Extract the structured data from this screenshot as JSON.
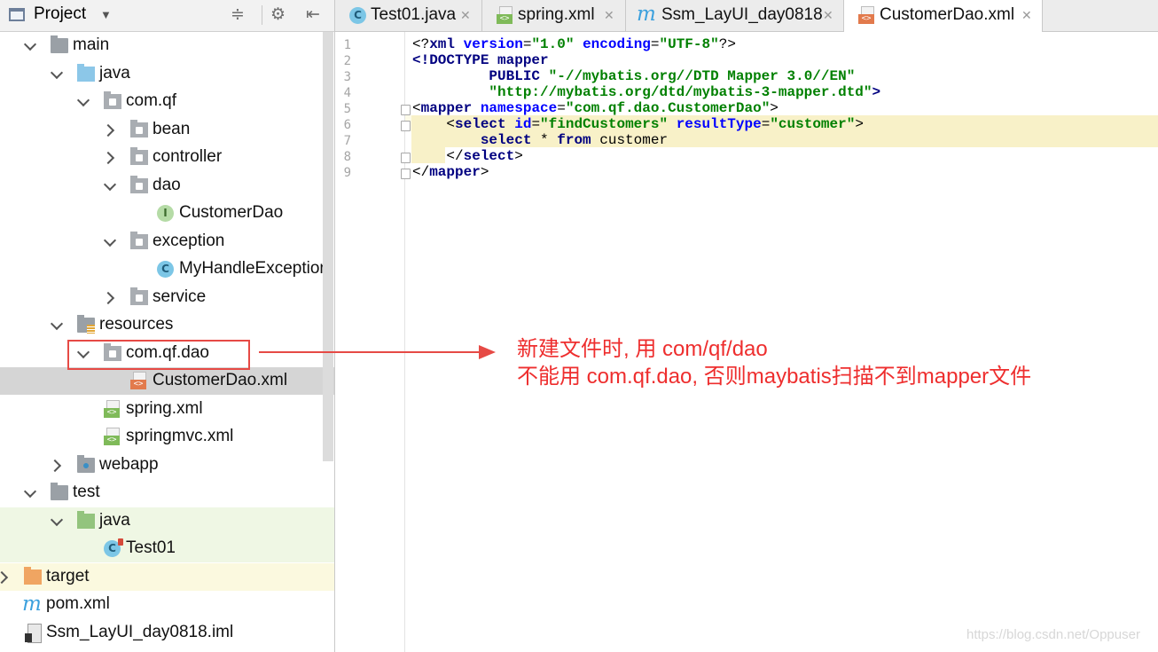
{
  "project_panel": {
    "title": "Project",
    "tree": [
      {
        "id": "main",
        "label": "main",
        "icon": "folder-gray",
        "expand": "down"
      },
      {
        "id": "java-main",
        "label": "java",
        "icon": "folder-blue",
        "expand": "down"
      },
      {
        "id": "pkg-comqf",
        "label": "com.qf",
        "icon": "package",
        "expand": "down"
      },
      {
        "id": "pkg-bean",
        "label": "bean",
        "icon": "package",
        "expand": "right"
      },
      {
        "id": "pkg-controller",
        "label": "controller",
        "icon": "package",
        "expand": "right"
      },
      {
        "id": "pkg-dao",
        "label": "dao",
        "icon": "package",
        "expand": "down"
      },
      {
        "id": "customerdao-iface",
        "label": "CustomerDao",
        "icon": "interface",
        "badge": "I"
      },
      {
        "id": "pkg-exception",
        "label": "exception",
        "icon": "package",
        "expand": "down"
      },
      {
        "id": "myhandleexception",
        "label": "MyHandleException",
        "icon": "class",
        "badge": "C"
      },
      {
        "id": "pkg-service",
        "label": "service",
        "icon": "package",
        "expand": "right"
      },
      {
        "id": "resources",
        "label": "resources",
        "icon": "resources-folder",
        "expand": "down"
      },
      {
        "id": "res-comqfdao",
        "label": "com.qf.dao",
        "icon": "package",
        "expand": "down"
      },
      {
        "id": "customerdao-xml",
        "label": "CustomerDao.xml",
        "icon": "xml-file",
        "selected": true
      },
      {
        "id": "spring-xml",
        "label": "spring.xml",
        "icon": "spring-xml-file"
      },
      {
        "id": "springmvc-xml",
        "label": "springmvc.xml",
        "icon": "spring-xml-file"
      },
      {
        "id": "webapp",
        "label": "webapp",
        "icon": "web-folder",
        "expand": "right"
      },
      {
        "id": "test",
        "label": "test",
        "icon": "folder-gray",
        "expand": "down"
      },
      {
        "id": "java-test",
        "label": "java",
        "icon": "folder-green",
        "expand": "down"
      },
      {
        "id": "test01",
        "label": "Test01",
        "icon": "test-class",
        "badge": "C"
      },
      {
        "id": "target",
        "label": "target",
        "icon": "folder-orange",
        "expand": "right"
      },
      {
        "id": "pom",
        "label": "pom.xml",
        "icon": "maven-icon",
        "badge": "m"
      },
      {
        "id": "iml",
        "label": "Ssm_LayUI_day0818.iml",
        "icon": "iml-file"
      }
    ]
  },
  "tabs": [
    {
      "label": "Test01.java",
      "icon": "class-icon",
      "badge": "C"
    },
    {
      "label": "spring.xml",
      "icon": "spring-xml-icon"
    },
    {
      "label": "Ssm_LayUI_day0818",
      "icon": "maven-icon",
      "badge": "m"
    },
    {
      "label": "CustomerDao.xml",
      "icon": "xml-icon",
      "active": true
    }
  ],
  "editor": {
    "line_numbers": [
      "1",
      "2",
      "3",
      "4",
      "5",
      "6",
      "7",
      "8",
      "9"
    ],
    "lines": [
      "<?xml version=\"1.0\" encoding=\"UTF-8\"?>",
      "<!DOCTYPE mapper",
      "        PUBLIC \"-//mybatis.org//DTD Mapper 3.0//EN\"",
      "        \"http://mybatis.org/dtd/mybatis-3-mapper.dtd\">",
      "<mapper namespace=\"com.qf.dao.CustomerDao\">",
      "    <select id=\"findCustomers\" resultType=\"customer\">",
      "        select * from customer",
      "    </select>",
      "</mapper>"
    ],
    "current_line": 6
  },
  "annotation": {
    "line1": "新建文件时, 用 com/qf/dao",
    "line2": "不能用 com.qf.dao, 否则maybatis扫描不到mapper文件",
    "color": "#e64a45"
  },
  "watermark": "https://blog.csdn.net/Oppuser"
}
